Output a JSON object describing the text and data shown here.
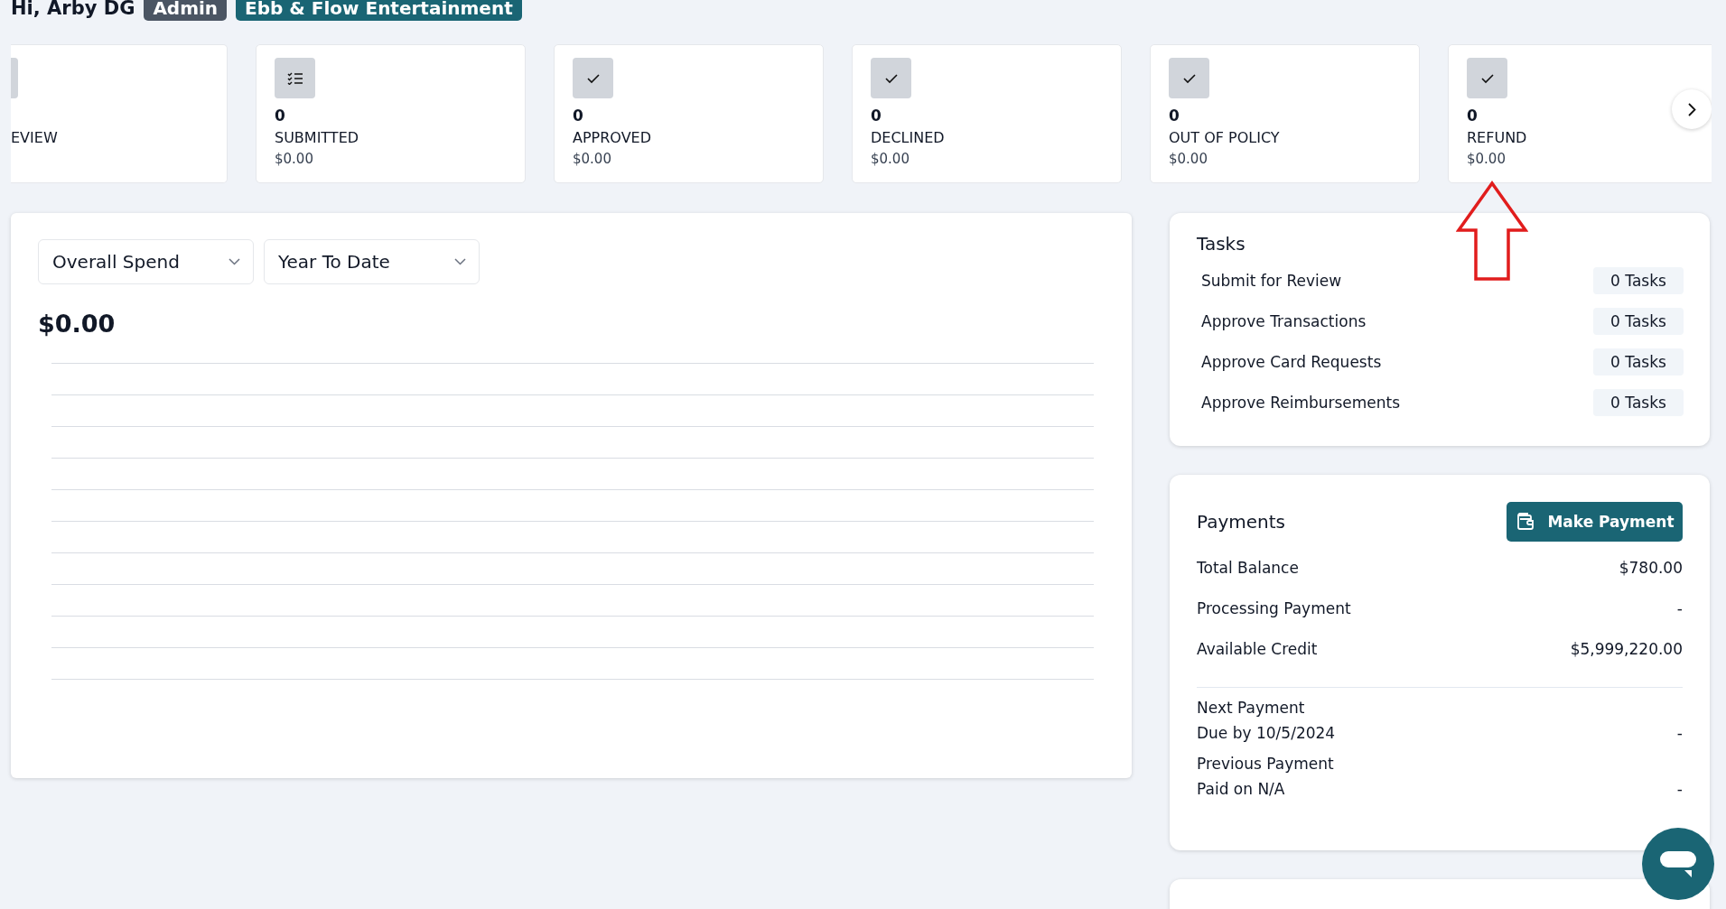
{
  "greeting": "Hi, Arby DG",
  "badges": [
    {
      "label": "Admin",
      "kind": "role"
    },
    {
      "label": "Ebb & Flow Entertainment",
      "kind": "company"
    }
  ],
  "status_cards": [
    {
      "kind": "partial",
      "label": "EVIEW"
    },
    {
      "kind": "list",
      "count": "0",
      "label": "SUBMITTED",
      "amount": "$0.00"
    },
    {
      "kind": "check",
      "count": "0",
      "label": "APPROVED",
      "amount": "$0.00"
    },
    {
      "kind": "check",
      "count": "0",
      "label": "DECLINED",
      "amount": "$0.00"
    },
    {
      "kind": "check",
      "count": "0",
      "label": "OUT OF POLICY",
      "amount": "$0.00"
    },
    {
      "kind": "check",
      "count": "0",
      "label": "REFUND",
      "amount": "$0.00"
    }
  ],
  "spend": {
    "filters": [
      {
        "label": "Overall Spend"
      },
      {
        "label": "Year To Date"
      }
    ],
    "total": "$0.00"
  },
  "tasks": {
    "title": "Tasks",
    "items": [
      {
        "label": "Submit for Review",
        "count": "0 Tasks"
      },
      {
        "label": "Approve Transactions",
        "count": "0 Tasks"
      },
      {
        "label": "Approve Card Requests",
        "count": "0 Tasks"
      },
      {
        "label": "Approve Reimbursements",
        "count": "0 Tasks"
      }
    ]
  },
  "payments": {
    "title": "Payments",
    "button": "Make Payment",
    "rows": [
      {
        "label": "Total Balance",
        "value": "$780.00"
      },
      {
        "label": "Processing Payment",
        "value": "-"
      },
      {
        "label": "Available Credit",
        "value": "$5,999,220.00"
      }
    ],
    "history": [
      {
        "title": "Next Payment",
        "detail": "Due by 10/5/2024",
        "value": "-"
      },
      {
        "title": "Previous Payment",
        "detail": "Paid on N/A",
        "value": "-"
      }
    ]
  }
}
